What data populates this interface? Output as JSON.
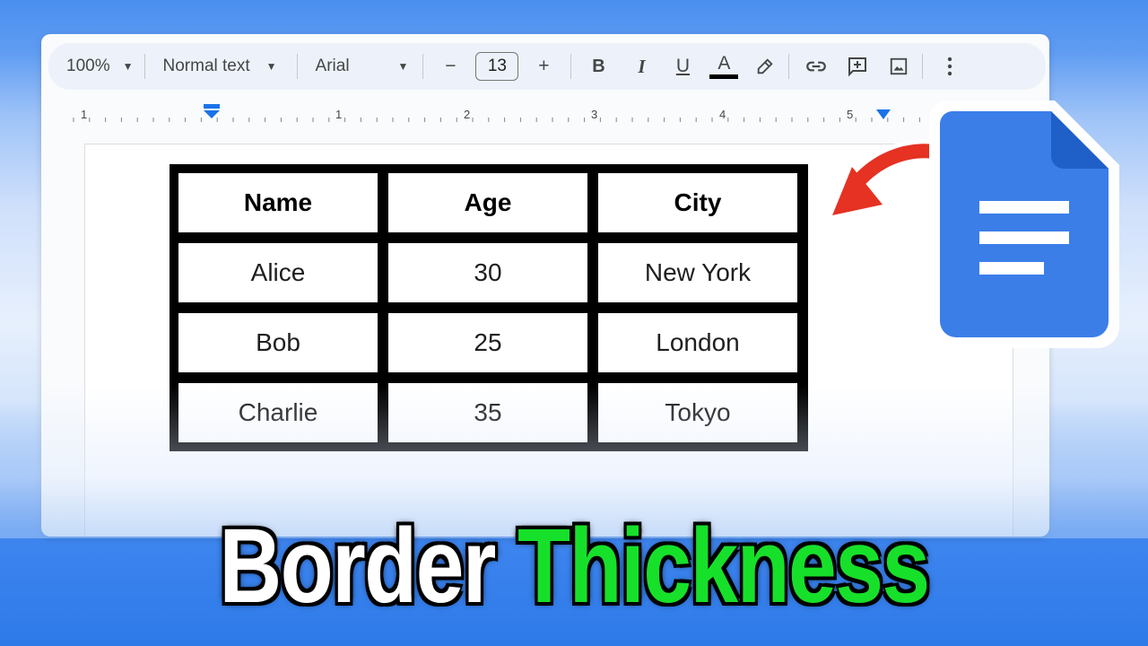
{
  "toolbar": {
    "zoom": "100%",
    "style": "Normal text",
    "font": "Arial",
    "font_size": "13",
    "minus": "−",
    "plus": "+",
    "bold": "B",
    "italic": "I",
    "underline": "U",
    "text_color": "A"
  },
  "ruler": {
    "numbers": [
      "1",
      "1",
      "2",
      "3",
      "4",
      "5"
    ]
  },
  "table": {
    "headers": [
      "Name",
      "Age",
      "City"
    ],
    "rows": [
      [
        "Alice",
        "30",
        "New York"
      ],
      [
        "Bob",
        "25",
        "London"
      ],
      [
        "Charlie",
        "35",
        "Tokyo"
      ]
    ]
  },
  "title": {
    "word1": "Border",
    "word2": "Thickness"
  },
  "colors": {
    "accent_green": "#17e02a",
    "docs_blue": "#3b7ee8",
    "arrow_red": "#e53222"
  }
}
